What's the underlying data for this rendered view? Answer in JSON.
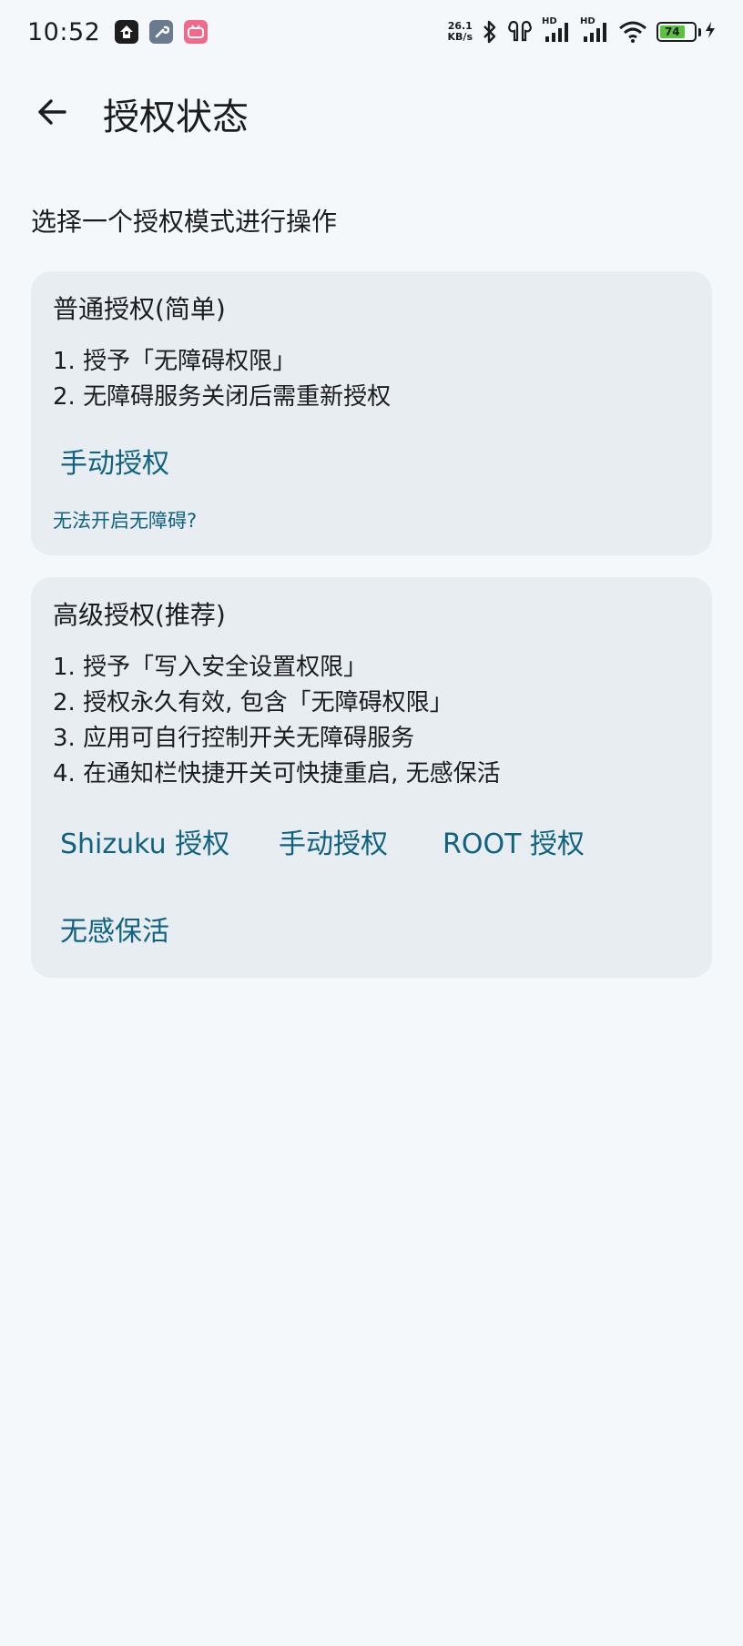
{
  "status_bar": {
    "time": "10:52",
    "net_speed_value": "26.1",
    "net_speed_unit": "KB/s",
    "signal_1_label": "HD",
    "signal_2_label": "HD",
    "battery_level": "74",
    "battery_color": "#5cc23e",
    "icons": [
      "app-dark-icon",
      "wrench-icon",
      "bilibili-icon",
      "bluetooth-icon",
      "earbuds-icon",
      "signal-icon",
      "signal-icon",
      "wifi-icon",
      "battery-icon",
      "charging-bolt-icon"
    ]
  },
  "app_bar": {
    "title": "授权状态",
    "back_icon": "arrow-back-icon"
  },
  "subtitle": "选择一个授权模式进行操作",
  "cards": [
    {
      "title": "普通授权(简单)",
      "lines": [
        "1. 授予「无障碍权限」",
        "2. 无障碍服务关闭后需重新授权"
      ],
      "buttons": [
        "手动授权"
      ],
      "help_link": "无法开启无障碍?"
    },
    {
      "title": "高级授权(推荐)",
      "lines": [
        "1. 授予「写入安全设置权限」",
        "2. 授权永久有效, 包含「无障碍权限」",
        "3. 应用可自行控制开关无障碍服务",
        "4. 在通知栏快捷开关可快捷重启, 无感保活"
      ],
      "buttons": [
        "Shizuku 授权",
        "手动授权",
        "ROOT 授权",
        "无感保活"
      ]
    }
  ],
  "colors": {
    "background": "#f5f8fb",
    "card": "#e8edf1",
    "accent": "#0f6381",
    "text": "#1b1c1e"
  }
}
